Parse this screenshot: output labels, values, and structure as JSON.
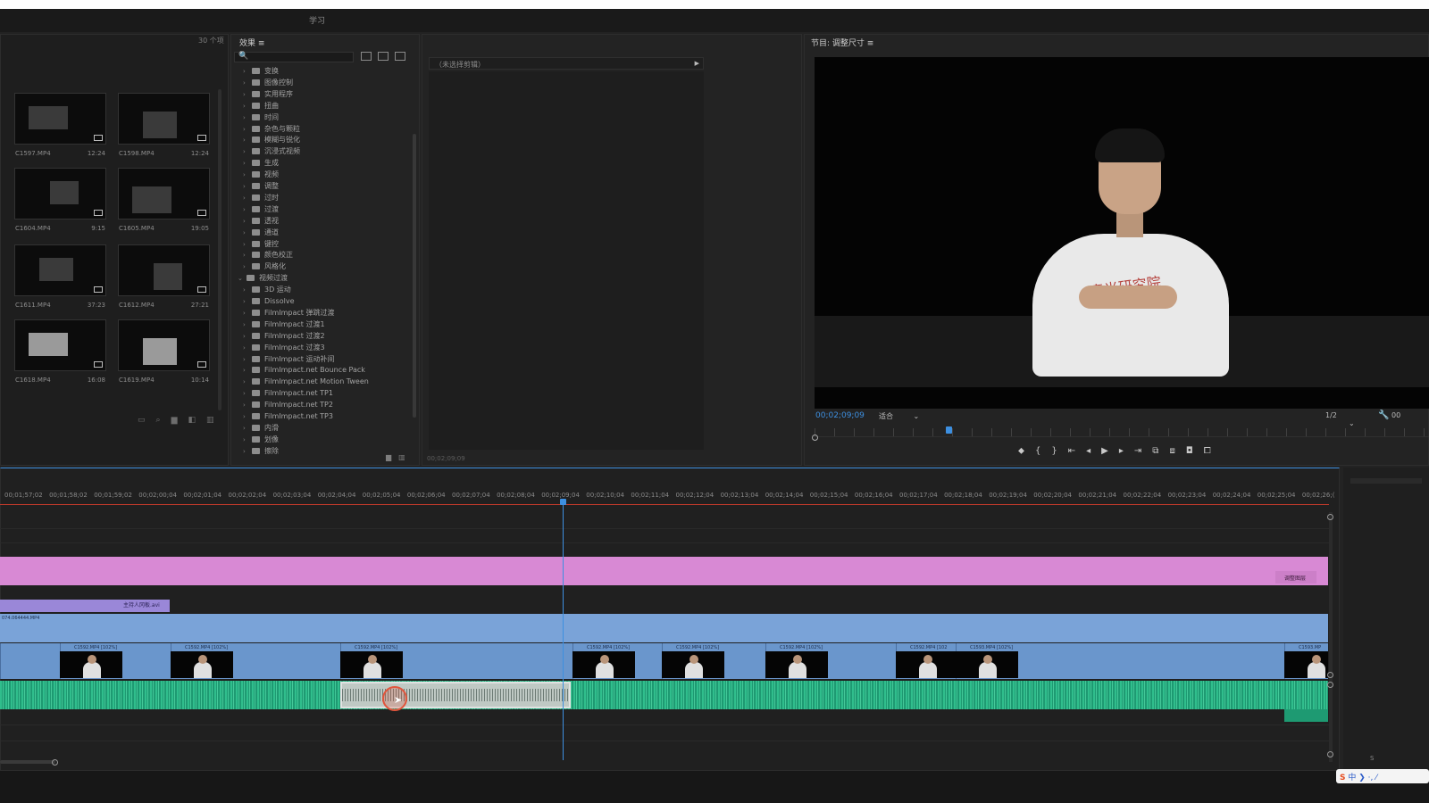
{
  "workspace": {
    "tab_label": "学习"
  },
  "project": {
    "item_count": "30 个项",
    "items": [
      {
        "name": "C1597.MP4",
        "duration": "12:24"
      },
      {
        "name": "C1598.MP4",
        "duration": "12:24"
      },
      {
        "name": "C1604.MP4",
        "duration": "9:15"
      },
      {
        "name": "C1605.MP4",
        "duration": "19:05"
      },
      {
        "name": "C1611.MP4",
        "duration": "37:23"
      },
      {
        "name": "C1612.MP4",
        "duration": "27:21"
      },
      {
        "name": "C1618.MP4",
        "duration": "16:08"
      },
      {
        "name": "C1619.MP4",
        "duration": "10:14"
      }
    ]
  },
  "effects": {
    "title": "效果 ≡",
    "search_icon": "🔍",
    "tree": [
      {
        "label": "变换",
        "indent": 0,
        "expanded": false
      },
      {
        "label": "图像控制",
        "indent": 0,
        "expanded": false
      },
      {
        "label": "实用程序",
        "indent": 0,
        "expanded": false
      },
      {
        "label": "扭曲",
        "indent": 0,
        "expanded": false
      },
      {
        "label": "时间",
        "indent": 0,
        "expanded": false
      },
      {
        "label": "杂色与颗粒",
        "indent": 0,
        "expanded": false
      },
      {
        "label": "模糊与锐化",
        "indent": 0,
        "expanded": false
      },
      {
        "label": "沉浸式视频",
        "indent": 0,
        "expanded": false
      },
      {
        "label": "生成",
        "indent": 0,
        "expanded": false
      },
      {
        "label": "视频",
        "indent": 0,
        "expanded": false
      },
      {
        "label": "调整",
        "indent": 0,
        "expanded": false
      },
      {
        "label": "过时",
        "indent": 0,
        "expanded": false
      },
      {
        "label": "过渡",
        "indent": 0,
        "expanded": false
      },
      {
        "label": "透视",
        "indent": 0,
        "expanded": false
      },
      {
        "label": "通道",
        "indent": 0,
        "expanded": false
      },
      {
        "label": "键控",
        "indent": 0,
        "expanded": false
      },
      {
        "label": "颜色校正",
        "indent": 0,
        "expanded": false
      },
      {
        "label": "风格化",
        "indent": 0,
        "expanded": false
      },
      {
        "label": "视频过渡",
        "indent": -1,
        "expanded": true
      },
      {
        "label": "3D 运动",
        "indent": 0,
        "expanded": false
      },
      {
        "label": "Dissolve",
        "indent": 0,
        "expanded": false
      },
      {
        "label": "FilmImpact 弹跳过渡",
        "indent": 0,
        "expanded": false
      },
      {
        "label": "FilmImpact 过渡1",
        "indent": 0,
        "expanded": false
      },
      {
        "label": "FilmImpact 过渡2",
        "indent": 0,
        "expanded": false
      },
      {
        "label": "FilmImpact 过渡3",
        "indent": 0,
        "expanded": false
      },
      {
        "label": "FilmImpact 运动补间",
        "indent": 0,
        "expanded": false
      },
      {
        "label": "FilmImpact.net Bounce Pack",
        "indent": 0,
        "expanded": false
      },
      {
        "label": "FilmImpact.net Motion Tween",
        "indent": 0,
        "expanded": false
      },
      {
        "label": "FilmImpact.net TP1",
        "indent": 0,
        "expanded": false
      },
      {
        "label": "FilmImpact.net TP2",
        "indent": 0,
        "expanded": false
      },
      {
        "label": "FilmImpact.net TP3",
        "indent": 0,
        "expanded": false
      },
      {
        "label": "内滑",
        "indent": 0,
        "expanded": false
      },
      {
        "label": "划像",
        "indent": 0,
        "expanded": false
      },
      {
        "label": "擦除",
        "indent": 0,
        "expanded": false
      }
    ]
  },
  "effect_controls": {
    "no_clip_label": "（未选择剪辑）",
    "timecode": "00;02;09;09"
  },
  "program": {
    "title": "节目: 调整尺寸 ≡",
    "timecode": "00;02;09;09",
    "fit_label": "适合",
    "resolution_label": "1/2",
    "tc_right": "00",
    "shirt_text": "春光研究院"
  },
  "timeline": {
    "ticks": [
      "00;01;57;02",
      "00;01;58;02",
      "00;01;59;02",
      "00;02;00;04",
      "00;02;01;04",
      "00;02;02;04",
      "00;02;03;04",
      "00;02;04;04",
      "00;02;05;04",
      "00;02;06;04",
      "00;02;07;04",
      "00;02;08;04",
      "00;02;09;04",
      "00;02;10;04",
      "00;02;11;04",
      "00;02;12;04",
      "00;02;13;04",
      "00;02;14;04",
      "00;02;15;04",
      "00;02;16;04",
      "00;02;17;04",
      "00;02;18;04",
      "00;02;19;04",
      "00;02;20;04",
      "00;02;21;04",
      "00;02;22;04",
      "00;02;23;04",
      "00;02;24;04",
      "00;02;25;04",
      "00;02;26;("
    ],
    "adjustment_label": "调整图层",
    "v3_label": "主持人冈板.avi",
    "v2_label": "074.064444.MP4",
    "v1_clips": [
      {
        "label": "C1592.MP4 [102%]"
      },
      {
        "label": "C1592.MP4 [102%]"
      },
      {
        "label": "C1592.MP4 [102%]"
      },
      {
        "label": "C1592.MP4 [102%]"
      },
      {
        "label": "C1592.MP4 [102%]"
      },
      {
        "label": "C1592.MP4 [102%]"
      },
      {
        "label": "C1592.MP4 [102"
      },
      {
        "label": "C1593.MP4 [102%]"
      },
      {
        "label": "C1593.MP"
      }
    ]
  },
  "right_strip": {
    "label": "S"
  },
  "ime": {
    "logo": "S",
    "text": "中 ❯ ·, ⁄"
  }
}
